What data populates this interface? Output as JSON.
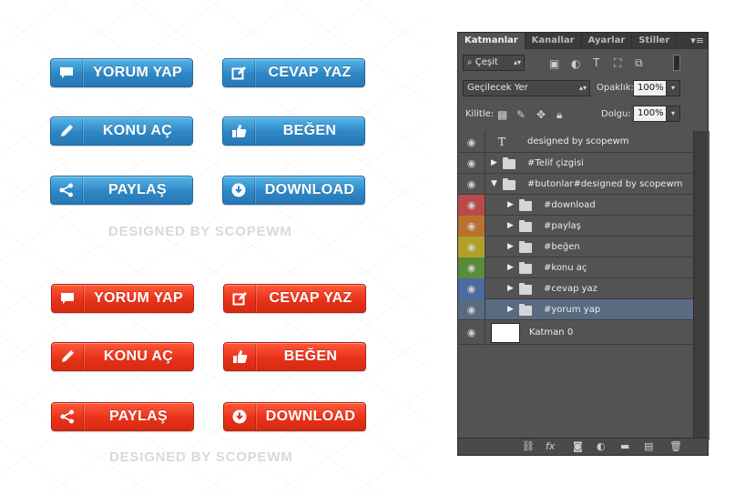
{
  "buttons_blue": [
    {
      "label": "YORUM YAP",
      "icon": "speech-bubble-icon"
    },
    {
      "label": "CEVAP YAZ",
      "icon": "edit-icon"
    },
    {
      "label": "KONU AÇ",
      "icon": "pencil-icon"
    },
    {
      "label": "BEĞEN",
      "icon": "thumbs-up-icon"
    },
    {
      "label": "PAYLAŞ",
      "icon": "share-icon"
    },
    {
      "label": "DOWNLOAD",
      "icon": "download-icon"
    }
  ],
  "buttons_red": [
    {
      "label": "YORUM YAP",
      "icon": "speech-bubble-icon"
    },
    {
      "label": "CEVAP YAZ",
      "icon": "edit-icon"
    },
    {
      "label": "KONU AÇ",
      "icon": "pencil-icon"
    },
    {
      "label": "BEĞEN",
      "icon": "thumbs-up-icon"
    },
    {
      "label": "PAYLAŞ",
      "icon": "share-icon"
    },
    {
      "label": "DOWNLOAD",
      "icon": "download-icon"
    }
  ],
  "designed_by": "DESIGNED BY SCOPEWM",
  "panel": {
    "tabs": [
      "Katmanlar",
      "Kanallar",
      "Ayarlar",
      "Stiller"
    ],
    "filter_label": "Çeşit",
    "blend_mode": "Geçilecek Yer",
    "opacity_label": "Opaklık:",
    "opacity_value": "100%",
    "lock_label": "Kilitle:",
    "fill_label": "Dolgu:",
    "fill_value": "100%",
    "layers": [
      {
        "name": "designed by scopewm",
        "kind": "text",
        "indent": 0,
        "color": ""
      },
      {
        "name": "#Telif çizgisi",
        "kind": "folder",
        "indent": 0,
        "color": ""
      },
      {
        "name": "#butonlar#designed by scopewm",
        "kind": "folder-open",
        "indent": 0,
        "color": ""
      },
      {
        "name": "#download",
        "kind": "folder",
        "indent": 1,
        "color": "#b84a4a"
      },
      {
        "name": "#paylaş",
        "kind": "folder",
        "indent": 1,
        "color": "#b8722e"
      },
      {
        "name": "#beğen",
        "kind": "folder",
        "indent": 1,
        "color": "#b0a02a"
      },
      {
        "name": "#konu aç",
        "kind": "folder",
        "indent": 1,
        "color": "#5a8a3a"
      },
      {
        "name": "#cevap yaz",
        "kind": "folder",
        "indent": 1,
        "color": "#4a6aa0"
      },
      {
        "name": "#yorum yap",
        "kind": "folder",
        "indent": 1,
        "color": "",
        "selected": true
      },
      {
        "name": "Katman 0",
        "kind": "image",
        "indent": 0,
        "color": ""
      }
    ]
  }
}
